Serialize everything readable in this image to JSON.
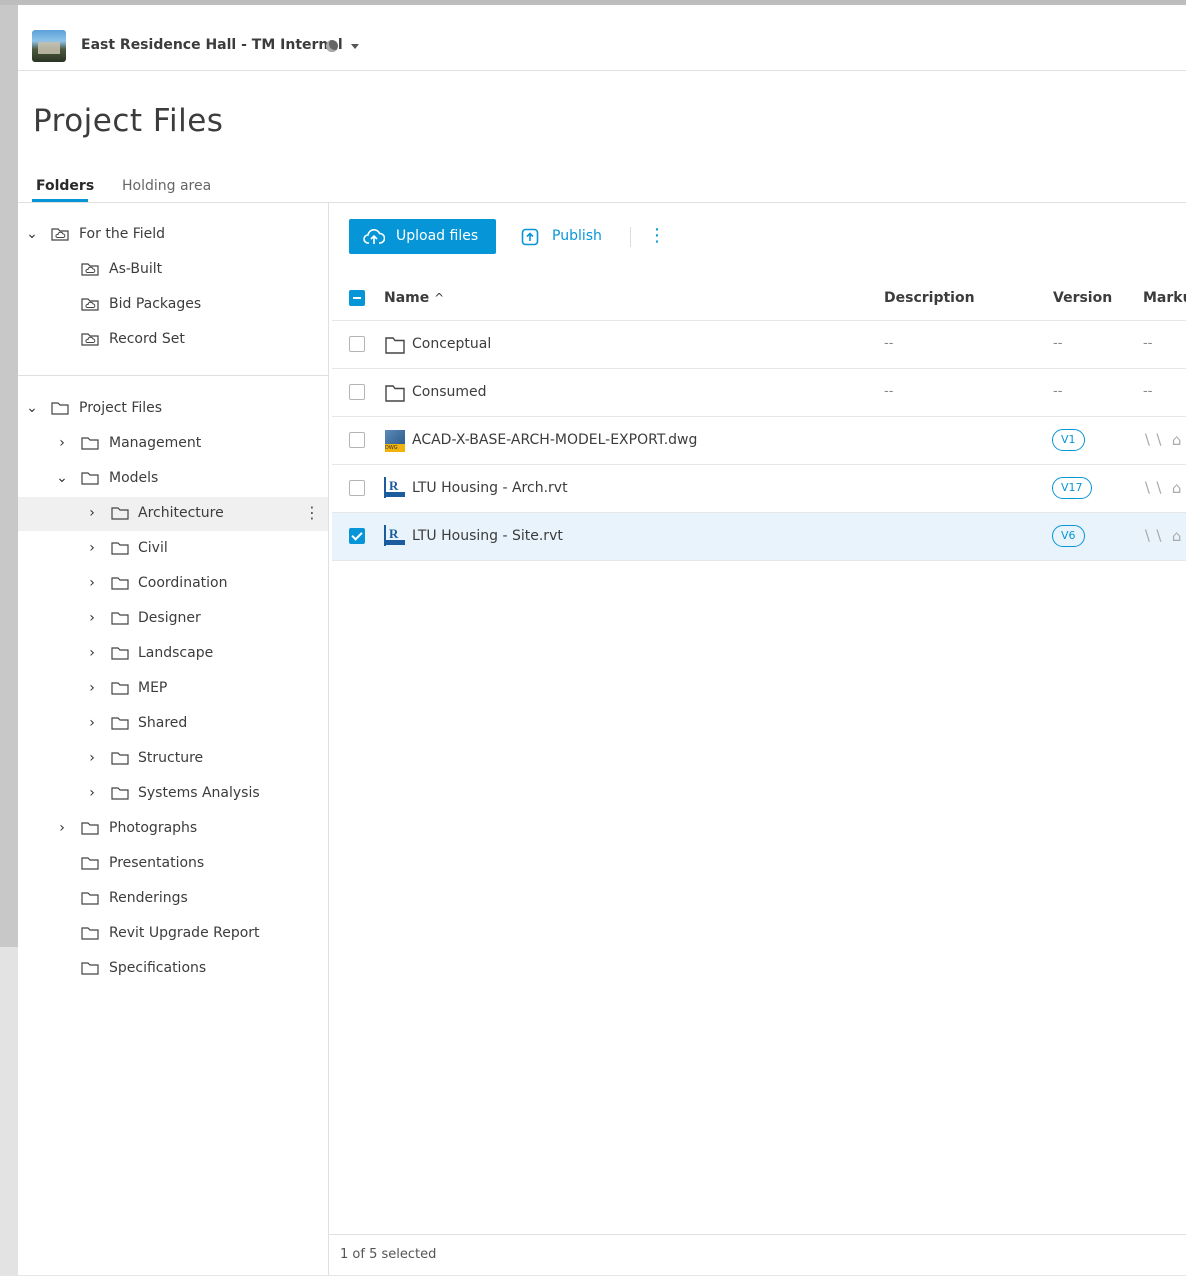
{
  "header": {
    "project_name": "East Residence Hall - TM Internal"
  },
  "page_title": "Project Files",
  "tabs": [
    {
      "label": "Folders",
      "active": true
    },
    {
      "label": "Holding area",
      "active": false
    }
  ],
  "sidebar": {
    "field_group": [
      {
        "label": "For the Field",
        "expanded": true
      },
      {
        "label": "As-Built"
      },
      {
        "label": "Bid Packages"
      },
      {
        "label": "Record Set"
      }
    ],
    "project_group": [
      {
        "label": "Project Files",
        "expanded": true
      },
      {
        "label": "Management"
      },
      {
        "label": "Models",
        "expanded": true
      },
      {
        "label": "Architecture",
        "highlighted": true
      },
      {
        "label": "Civil"
      },
      {
        "label": "Coordination"
      },
      {
        "label": "Designer"
      },
      {
        "label": "Landscape"
      },
      {
        "label": "MEP"
      },
      {
        "label": "Shared"
      },
      {
        "label": "Structure"
      },
      {
        "label": "Systems Analysis"
      },
      {
        "label": "Photographs"
      },
      {
        "label": "Presentations"
      },
      {
        "label": "Renderings"
      },
      {
        "label": "Revit Upgrade Report"
      },
      {
        "label": "Specifications"
      }
    ]
  },
  "toolbar": {
    "upload_label": "Upload files",
    "publish_label": "Publish"
  },
  "grid": {
    "columns": {
      "name": "Name",
      "sort_indicator": "^",
      "description": "Description",
      "version": "Version",
      "markups": "Marku"
    },
    "rows": [
      {
        "type": "folder",
        "name": "Conceptual",
        "description": "--",
        "version": "--",
        "markups": "--",
        "selected": false
      },
      {
        "type": "folder",
        "name": "Consumed",
        "description": "--",
        "version": "--",
        "markups": "--",
        "selected": false
      },
      {
        "type": "dwg",
        "name": "ACAD-X-BASE-ARCH-MODEL-EXPORT.dwg",
        "description": "",
        "version": "V1",
        "selected": false
      },
      {
        "type": "rvt",
        "name": "LTU Housing - Arch.rvt",
        "description": "",
        "version": "V17",
        "selected": false
      },
      {
        "type": "rvt",
        "name": "LTU Housing - Site.rvt",
        "description": "",
        "version": "V6",
        "selected": true
      }
    ]
  },
  "footer": {
    "selection_status": "1 of 5 selected"
  },
  "colors": {
    "accent": "#0696d7",
    "selected_row": "#e9f3fb"
  }
}
